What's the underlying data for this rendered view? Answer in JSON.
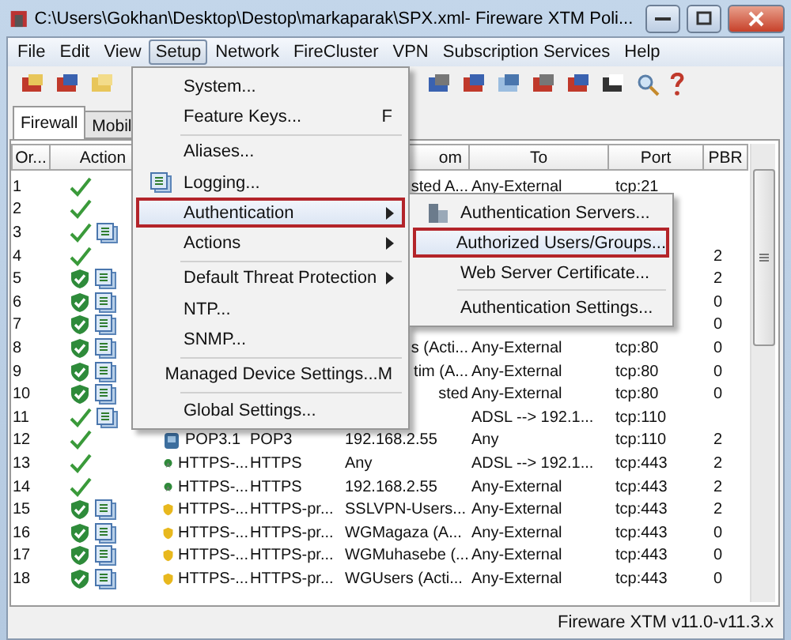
{
  "window": {
    "title": "C:\\Users\\Gokhan\\Desktop\\Destop\\markaparak\\SPX.xml- Fireware XTM Poli..."
  },
  "menu_bar": [
    {
      "label": "File",
      "selected": false
    },
    {
      "label": "Edit",
      "selected": false
    },
    {
      "label": "View",
      "selected": false
    },
    {
      "label": "Setup",
      "selected": true
    },
    {
      "label": "Network",
      "selected": false
    },
    {
      "label": "FireCluster",
      "selected": false
    },
    {
      "label": "VPN",
      "selected": false
    },
    {
      "label": "Subscription Services",
      "selected": false
    },
    {
      "label": "Help",
      "selected": false
    }
  ],
  "tabs": [
    {
      "label": "Firewall",
      "selected": true
    },
    {
      "label": "Mobil",
      "selected": false
    }
  ],
  "table": {
    "columns": {
      "order": "Or...",
      "action": "Action",
      "from": "om",
      "to": "To",
      "port": "Port",
      "pbr": "PBR"
    },
    "rows": [
      {
        "order": "1",
        "kind": "allow",
        "logging": false,
        "from": "sted A...",
        "to": "Any-External",
        "port": "tcp:21"
      },
      {
        "order": "2",
        "kind": "allow",
        "logging": false
      },
      {
        "order": "3",
        "kind": "allow",
        "logging": true
      },
      {
        "order": "4",
        "kind": "allow",
        "logging": false,
        "pbr": "2"
      },
      {
        "order": "5",
        "kind": "proxy",
        "logging": true,
        "pbr": "2"
      },
      {
        "order": "6",
        "kind": "proxy",
        "logging": true,
        "pbr": "0"
      },
      {
        "order": "7",
        "kind": "proxy",
        "logging": true,
        "pbr": "0"
      },
      {
        "order": "8",
        "kind": "proxy",
        "logging": true,
        "from": "s (Acti...",
        "to": "Any-External",
        "port": "tcp:80",
        "pbr": "0"
      },
      {
        "order": "9",
        "kind": "proxy",
        "logging": true,
        "from": "tim (A...",
        "to": "Any-External",
        "port": "tcp:80",
        "pbr": "0"
      },
      {
        "order": "10",
        "kind": "proxy",
        "logging": true,
        "from": "sted",
        "to": "Any-External",
        "port": "tcp:80",
        "pbr": "0"
      },
      {
        "order": "11",
        "kind": "allow",
        "logging": true,
        "to": "ADSL --> 192.1...",
        "port": "tcp:110"
      },
      {
        "order": "12",
        "kind": "allow",
        "logging": false,
        "policy": {
          "kind": "page",
          "name": "POP3.1"
        },
        "type": "POP3",
        "from": "192.168.2.55",
        "to": "Any",
        "port": "tcp:110",
        "pbr": "2"
      },
      {
        "order": "13",
        "kind": "allow",
        "logging": false,
        "policy": {
          "kind": "globe",
          "name": "HTTPS-..."
        },
        "type": "HTTPS",
        "from": "Any",
        "to": "ADSL --> 192.1...",
        "port": "tcp:443",
        "pbr": "2"
      },
      {
        "order": "14",
        "kind": "allow",
        "logging": false,
        "policy": {
          "kind": "globe",
          "name": "HTTPS-..."
        },
        "type": "HTTPS",
        "from": "192.168.2.55",
        "to": "Any-External",
        "port": "tcp:443",
        "pbr": "2"
      },
      {
        "order": "15",
        "kind": "proxy",
        "logging": true,
        "policy": {
          "kind": "shield",
          "name": "HTTPS-..."
        },
        "type": "HTTPS-pr...",
        "from": "SSLVPN-Users...",
        "to": "Any-External",
        "port": "tcp:443",
        "pbr": "2"
      },
      {
        "order": "16",
        "kind": "proxy",
        "logging": true,
        "policy": {
          "kind": "shield",
          "name": "HTTPS-..."
        },
        "type": "HTTPS-pr...",
        "from": "WGMagaza (A...",
        "to": "Any-External",
        "port": "tcp:443",
        "pbr": "0"
      },
      {
        "order": "17",
        "kind": "proxy",
        "logging": true,
        "policy": {
          "kind": "shield",
          "name": "HTTPS-..."
        },
        "type": "HTTPS-pr...",
        "from": "WGMuhasebe (...",
        "to": "Any-External",
        "port": "tcp:443",
        "pbr": "0"
      },
      {
        "order": "18",
        "kind": "proxy",
        "logging": true,
        "policy": {
          "kind": "shield",
          "name": "HTTPS-..."
        },
        "type": "HTTPS-pr...",
        "from": "WGUsers (Acti...",
        "to": "Any-External",
        "port": "tcp:443",
        "pbr": "0"
      }
    ]
  },
  "setup_menu": [
    {
      "kind": "item",
      "label": "System...",
      "submenu": false,
      "selected": false
    },
    {
      "kind": "item",
      "label": "Feature Keys...",
      "shortcut": "F",
      "submenu": false,
      "selected": false
    },
    {
      "kind": "separator"
    },
    {
      "kind": "item",
      "label": "Aliases...",
      "submenu": false,
      "selected": false
    },
    {
      "kind": "item",
      "label": "Logging...",
      "icon": true,
      "submenu": false,
      "selected": false
    },
    {
      "kind": "item",
      "label": "Authentication",
      "submenu": true,
      "selected": true
    },
    {
      "kind": "item",
      "label": "Actions",
      "submenu": true,
      "selected": false
    },
    {
      "kind": "separator"
    },
    {
      "kind": "item",
      "label": "Default Threat Protection",
      "submenu": true,
      "selected": false
    },
    {
      "kind": "item",
      "label": "NTP...",
      "submenu": false,
      "selected": false
    },
    {
      "kind": "item",
      "label": "SNMP...",
      "submenu": false,
      "selected": false
    },
    {
      "kind": "separator"
    },
    {
      "kind": "item",
      "label": "Managed Device Settings...",
      "shortcut": "M",
      "submenu": false,
      "selected": false
    },
    {
      "kind": "separator"
    },
    {
      "kind": "item",
      "label": "Global Settings...",
      "submenu": false,
      "selected": false
    }
  ],
  "authentication_submenu": [
    {
      "kind": "item",
      "label": "Authentication Servers...",
      "icon": true,
      "selected": false
    },
    {
      "kind": "item",
      "label": "Authorized Users/Groups...",
      "selected": true
    },
    {
      "kind": "item",
      "label": "Web Server Certificate...",
      "selected": false
    },
    {
      "kind": "separator"
    },
    {
      "kind": "item",
      "label": "Authentication Settings...",
      "selected": false
    }
  ],
  "status_bar": {
    "text": "Fireware XTM v11.0-v11.3.x"
  }
}
